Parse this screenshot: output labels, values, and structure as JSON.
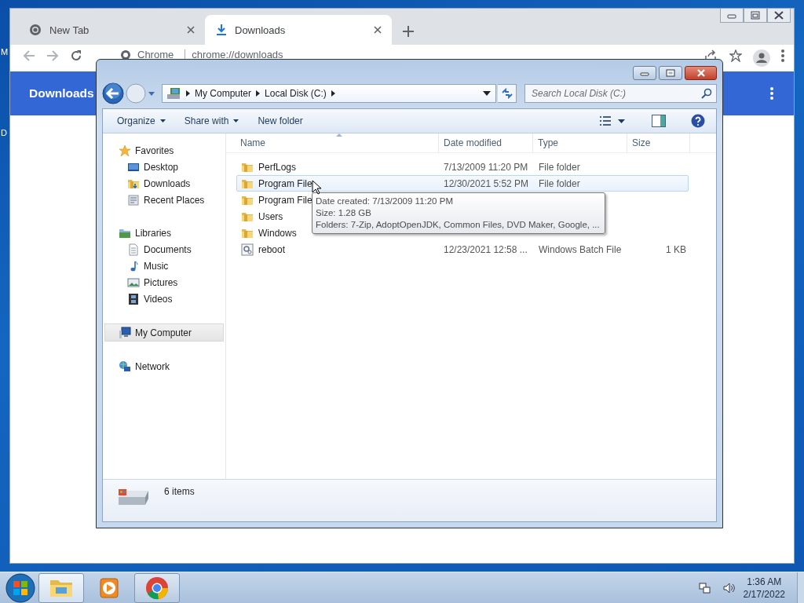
{
  "desktop": {
    "icon_labels": [
      "M",
      "D"
    ]
  },
  "browser": {
    "tabs": [
      {
        "title": "New Tab",
        "selected": false
      },
      {
        "title": "Downloads",
        "selected": true
      }
    ],
    "address": {
      "site": "Chrome",
      "url": "chrome://downloads"
    },
    "page_title": "Downloads"
  },
  "explorer": {
    "breadcrumb": [
      "My Computer",
      "Local Disk (C:)"
    ],
    "search": {
      "placeholder": "Search Local Disk (C:)"
    },
    "toolbar": [
      {
        "label": "Organize",
        "dropdown": true
      },
      {
        "label": "Share with",
        "dropdown": true
      },
      {
        "label": "New folder",
        "dropdown": false
      }
    ],
    "nav": [
      {
        "label": "Favorites",
        "selected": false,
        "children": [
          {
            "label": "Desktop",
            "selected": false
          },
          {
            "label": "Downloads",
            "selected": false
          },
          {
            "label": "Recent Places",
            "selected": false
          }
        ]
      },
      {
        "label": "Libraries",
        "selected": false,
        "children": [
          {
            "label": "Documents",
            "selected": false
          },
          {
            "label": "Music",
            "selected": false
          },
          {
            "label": "Pictures",
            "selected": false
          },
          {
            "label": "Videos",
            "selected": false
          }
        ]
      },
      {
        "label": "My Computer",
        "selected": true
      },
      {
        "label": "Network",
        "selected": false
      }
    ],
    "columns": [
      {
        "label": "Name",
        "sorted": true
      },
      {
        "label": "Date modified",
        "sorted": false
      },
      {
        "label": "Type",
        "sorted": false
      },
      {
        "label": "Size",
        "sorted": false
      }
    ],
    "rows": [
      {
        "name": "PerfLogs",
        "date": "7/13/2009 11:20 PM",
        "type": "File folder",
        "kind": "folder",
        "selected": false
      },
      {
        "name": "Program File",
        "date": "12/30/2021 5:52 PM",
        "type": "File folder",
        "kind": "folder",
        "selected": true
      },
      {
        "name": "Program File",
        "kind": "folder",
        "selected": false
      },
      {
        "name": "Users",
        "kind": "folder",
        "selected": false
      },
      {
        "name": "Windows",
        "kind": "folder",
        "selected": false
      },
      {
        "name": "reboot",
        "date": "12/23/2021 12:58 ...",
        "type": "Windows Batch File",
        "size": "1 KB",
        "kind": "batch",
        "selected": false
      }
    ],
    "tooltip": [
      "Date created: 7/13/2009 11:20 PM",
      "Size: 1.28 GB",
      "Folders: 7-Zip, AdoptOpenJDK, Common Files, DVD Maker, Google, ..."
    ],
    "status": "6 items"
  },
  "taskbar": {
    "buttons": [
      {
        "running": true,
        "selected": true
      },
      {
        "running": false,
        "selected": false
      },
      {
        "running": true,
        "selected": false
      }
    ],
    "time": "1:36 AM",
    "date": "2/17/2022"
  }
}
